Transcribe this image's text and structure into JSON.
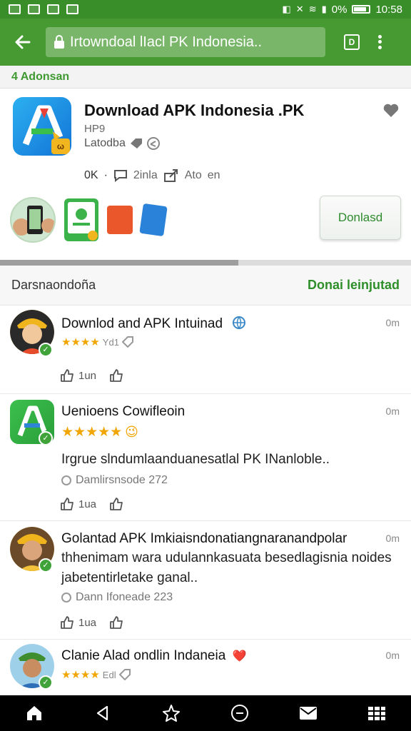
{
  "status_bar": {
    "battery_text": "0%",
    "time": "10:58",
    "battery_level": 0.85,
    "icons": [
      "notification-icon",
      "notification-icon",
      "notification-icon",
      "notification-icon",
      "mute-icon",
      "bluetooth-off-icon",
      "wifi-icon",
      "signal-icon",
      "battery-icon"
    ]
  },
  "toolbar": {
    "url_text": "Irtowndoal lIacl PK Indonesia..",
    "tab_count": "D",
    "theme_color": "#469a31"
  },
  "breadcrumb": {
    "label": "4 Adonsan"
  },
  "app": {
    "title": "Download APK Indonesia .PK",
    "subtitle": "HP9",
    "developer": "Latodba",
    "badge": "ω",
    "stats": {
      "downloads": "0K",
      "separator": "·",
      "comments": "2inla",
      "shares": "Ato",
      "extra": "en"
    },
    "download_label": "Donlasd"
  },
  "progress": {
    "value": 0.58
  },
  "section": {
    "title": "Darsnaondoña",
    "link": "Donai leinjutad"
  },
  "reviews": [
    {
      "title": "Downlod and APK Intuinad",
      "time": "0m",
      "stars": "★★★★",
      "rating_text": "Yd1",
      "likes": "1un"
    },
    {
      "title": "Uenioens Cowifleoin",
      "time": "0m",
      "stars": "★★★★★",
      "emoji": "😉",
      "body": "Irgrue slndumlaanduanesatlal PK INanloble..",
      "meta": "Damlirsnsode 272",
      "likes": "1ua"
    },
    {
      "title": "Golantad APK Imkiaisndonatiangnaranandpolar",
      "time": "0m",
      "body": "thhenimam wara udulannkasuata besedlagisnia noides jabetentirletake ganal..",
      "meta": "Dann Ifoneade 223",
      "likes": "1ua"
    },
    {
      "title": "Clanie Alad ondlin Indaneia",
      "time": "0m",
      "emoji": "❤️",
      "stars": "★★★★",
      "rating_text": "Edl"
    }
  ],
  "bottom_nav": [
    "home-icon",
    "back-icon",
    "recent-icon",
    "circle-icon",
    "mail-icon",
    "grid-icon"
  ]
}
